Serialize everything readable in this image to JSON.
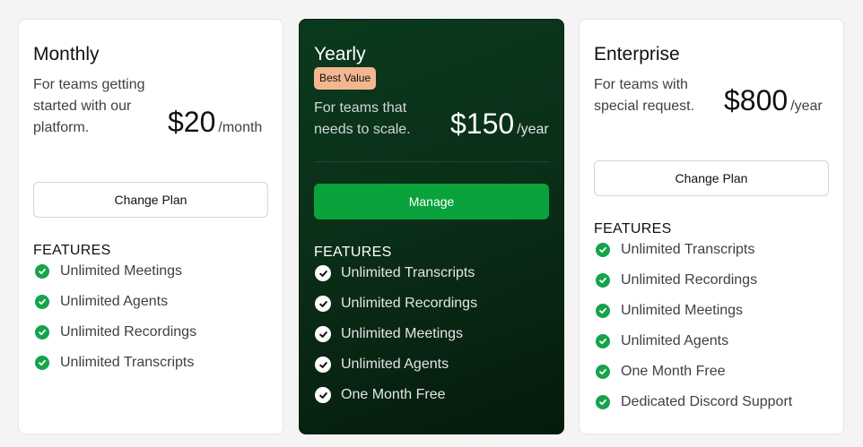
{
  "plans": [
    {
      "title": "Monthly",
      "description": "For teams getting started with our platform.",
      "price": "$20",
      "period": "/month",
      "button": "Change Plan",
      "features_heading": "FEATURES",
      "features": [
        "Unlimited Meetings",
        "Unlimited Agents",
        "Unlimited Recordings",
        "Unlimited Transcripts"
      ]
    },
    {
      "title": "Yearly",
      "badge": "Best Value",
      "description": "For teams that needs to scale.",
      "price": "$150",
      "period": "/year",
      "button": "Manage",
      "features_heading": "FEATURES",
      "features": [
        "Unlimited Transcripts",
        "Unlimited Recordings",
        "Unlimited Meetings",
        "Unlimited Agents",
        "One Month Free"
      ]
    },
    {
      "title": "Enterprise",
      "description": "For teams with special request.",
      "price": "$800",
      "period": "/year",
      "button": "Change Plan",
      "features_heading": "FEATURES",
      "features": [
        "Unlimited Transcripts",
        "Unlimited Recordings",
        "Unlimited Meetings",
        "Unlimited Agents",
        "One Month Free",
        "Dedicated Discord Support"
      ]
    }
  ],
  "colors": {
    "accent_green": "#0aa23b",
    "badge_bg": "#f3b690",
    "featured_card_bg": "#0b2f18"
  }
}
